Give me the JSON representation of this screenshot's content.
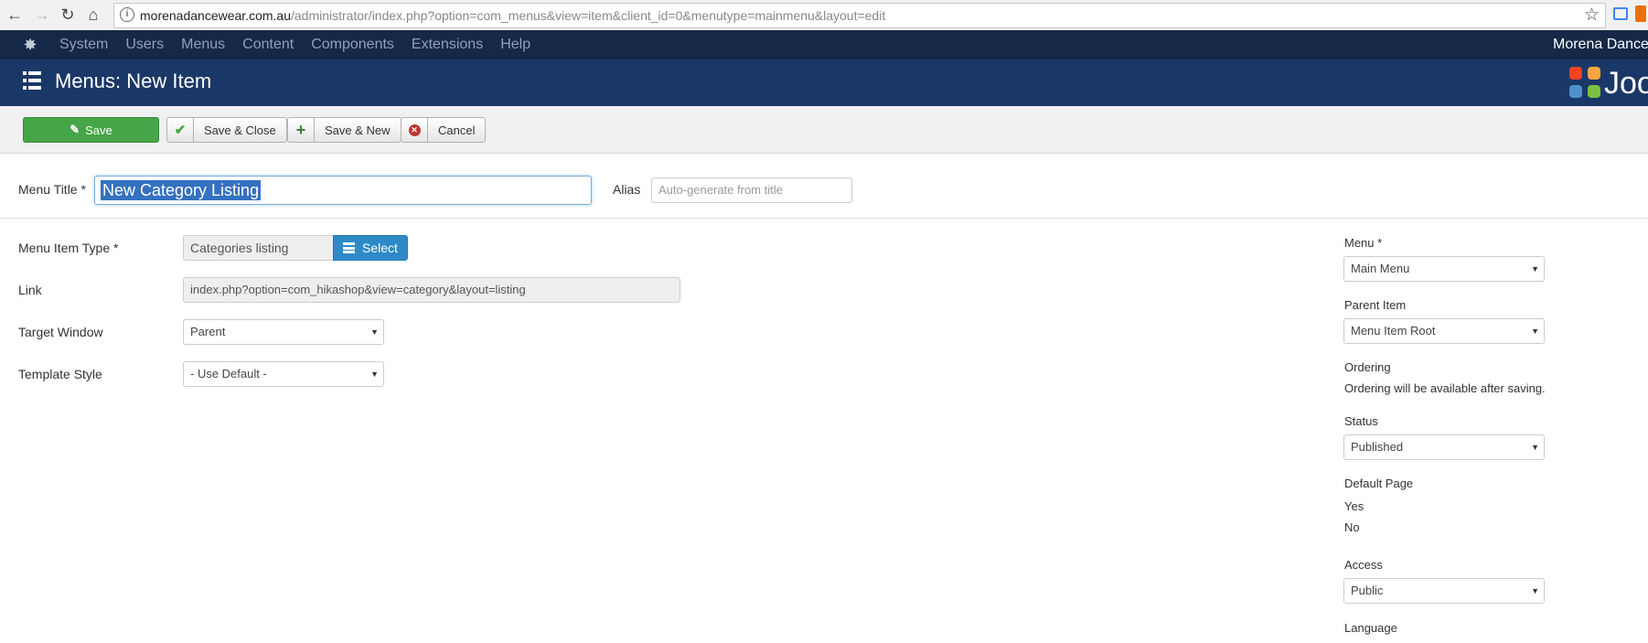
{
  "browser": {
    "url_host": "morenadancewear.com.au",
    "url_path": "/administrator/index.php?option=com_menus&view=item&client_id=0&menutype=mainmenu&layout=edit"
  },
  "topnav": {
    "items": [
      "System",
      "Users",
      "Menus",
      "Content",
      "Components",
      "Extensions",
      "Help"
    ],
    "site_name": "Morena Dancew"
  },
  "header": {
    "title": "Menus: New Item",
    "brand": "Joo"
  },
  "toolbar": {
    "save": "Save",
    "save_close": "Save & Close",
    "save_new": "Save & New",
    "cancel": "Cancel"
  },
  "form": {
    "menu_title_label": "Menu Title *",
    "menu_title_value": "New Category Listing",
    "alias_label": "Alias",
    "alias_placeholder": "Auto-generate from title",
    "menu_item_type_label": "Menu Item Type *",
    "menu_item_type_value": "Categories listing",
    "select_button": "Select",
    "link_label": "Link",
    "link_value": "index.php?option=com_hikashop&view=category&layout=listing",
    "target_window_label": "Target Window",
    "target_window_value": "Parent",
    "template_style_label": "Template Style",
    "template_style_value": "- Use Default -"
  },
  "sidebar": {
    "menu_label": "Menu *",
    "menu_value": "Main Menu",
    "parent_item_label": "Parent Item",
    "parent_item_value": "Menu Item Root",
    "ordering_label": "Ordering",
    "ordering_note": "Ordering will be available after saving.",
    "status_label": "Status",
    "status_value": "Published",
    "default_page_label": "Default Page",
    "default_page_yes": "Yes",
    "default_page_no": "No",
    "access_label": "Access",
    "access_value": "Public",
    "language_label": "Language"
  },
  "colors": {
    "topnav_bg": "#152847",
    "header_bg": "#1a3867",
    "save_green": "#46a546",
    "select_blue": "#2d8ac7"
  }
}
